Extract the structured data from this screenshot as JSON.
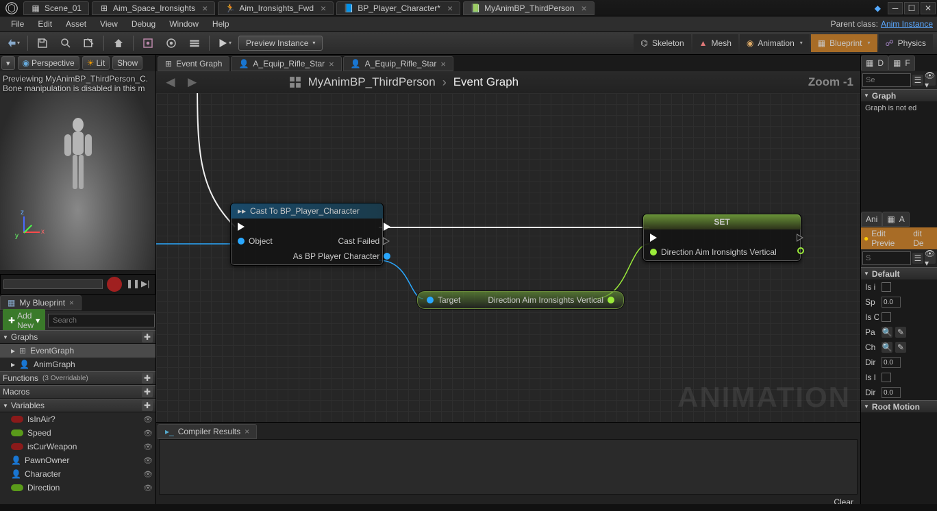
{
  "titlebar": {
    "tabs": [
      {
        "label": "Scene_01"
      },
      {
        "label": "Aim_Space_Ironsights"
      },
      {
        "label": "Aim_Ironsights_Fwd"
      },
      {
        "label": "BP_Player_Character*"
      },
      {
        "label": "MyAnimBP_ThirdPerson",
        "active": true
      }
    ]
  },
  "menubar": {
    "items": [
      "File",
      "Edit",
      "Asset",
      "View",
      "Debug",
      "Window",
      "Help"
    ],
    "parent_class_label": "Parent class:",
    "parent_class": "Anim Instance"
  },
  "toolbar": {
    "preview_instance": "Preview Instance",
    "modes": [
      {
        "label": "Skeleton"
      },
      {
        "label": "Mesh"
      },
      {
        "label": "Animation",
        "dd": true
      },
      {
        "label": "Blueprint",
        "active": true,
        "dd": true
      },
      {
        "label": "Physics"
      }
    ]
  },
  "viewport": {
    "buttons": [
      "Perspective",
      "Lit",
      "Show"
    ],
    "overlay_l1": "Previewing MyAnimBP_ThirdPerson_C.",
    "overlay_l2": "Bone manipulation is disabled in this m"
  },
  "mybp": {
    "tab": "My Blueprint",
    "add_new": "Add New",
    "search_placeholder": "Search",
    "cats": {
      "graphs": "Graphs",
      "functions": "Functions",
      "functions_sub": "(3 Overridable)",
      "macros": "Macros",
      "variables": "Variables"
    },
    "graphs": [
      {
        "label": "EventGraph",
        "sel": true
      },
      {
        "label": "AnimGraph"
      }
    ],
    "vars": [
      {
        "label": "IsInAir?",
        "type": "red"
      },
      {
        "label": "Speed",
        "type": "green"
      },
      {
        "label": "isCurWeapon",
        "type": "red"
      },
      {
        "label": "PawnOwner",
        "type": "obj"
      },
      {
        "label": "Character",
        "type": "obj"
      },
      {
        "label": "Direction",
        "type": "green"
      }
    ]
  },
  "graph": {
    "tabs": [
      {
        "label": "Event Graph",
        "active": true
      },
      {
        "label": "A_Equip_Rifle_Star"
      },
      {
        "label": "A_Equip_Rifle_Star"
      }
    ],
    "breadcrumb_main": "MyAnimBP_ThirdPerson",
    "breadcrumb_leaf": "Event Graph",
    "zoom": "Zoom -1",
    "watermark": "ANIMATION",
    "nodes": {
      "cast": {
        "title": "Cast To BP_Player_Character",
        "object": "Object",
        "cast_failed": "Cast Failed",
        "as_char": "As BP Player Character"
      },
      "pure": {
        "target": "Target",
        "out": "Direction Aim Ironsights Vertical"
      },
      "set": {
        "title": "SET",
        "var": "Direction Aim Ironsights Vertical"
      }
    }
  },
  "compiler": {
    "tab": "Compiler Results",
    "clear": "Clear"
  },
  "right": {
    "tab1_a": "Ani",
    "tab1_b": "A",
    "det_a": "D",
    "find_a": "F",
    "search_placeholder": "Se",
    "graph_h": "Graph",
    "graph_info": "Graph is not ed",
    "edit_preview": "Edit Previe",
    "edit_def": "dit De",
    "default_h": "Default",
    "rootmotion_h": "Root Motion",
    "props": [
      {
        "lbl": "Is i",
        "ctl": "check"
      },
      {
        "lbl": "Sp",
        "ctl": "num",
        "val": "0.0"
      },
      {
        "lbl": "Is C",
        "ctl": "check"
      },
      {
        "lbl": "Pa",
        "ctl": "picker"
      },
      {
        "lbl": "Ch",
        "ctl": "picker"
      },
      {
        "lbl": "Dir",
        "ctl": "num",
        "val": "0.0"
      },
      {
        "lbl": "Is I",
        "ctl": "check"
      },
      {
        "lbl": "Dir",
        "ctl": "num",
        "val": "0.0"
      }
    ]
  }
}
